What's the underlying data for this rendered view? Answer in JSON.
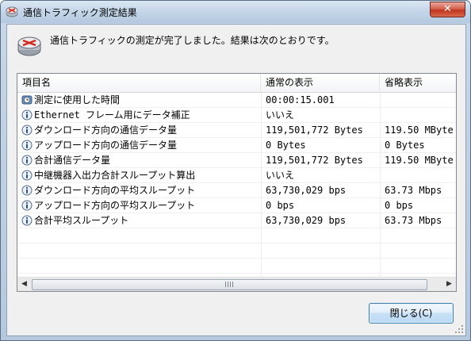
{
  "window": {
    "title": "通信トラフィック測定結果",
    "close_symbol": "✕"
  },
  "message": "通信トラフィックの測定が完了しました。結果は次のとおりです。",
  "table": {
    "columns": [
      "項目名",
      "通常の表示",
      "省略表示"
    ],
    "rows": [
      {
        "icon": "clock-icon",
        "name": "測定に使用した時間",
        "normal": "00:00:15.001",
        "short": ""
      },
      {
        "icon": "info-icon",
        "name": "Ethernet フレーム用にデータ補正",
        "normal": "いいえ",
        "short": ""
      },
      {
        "icon": "info-icon",
        "name": "ダウンロード方向の通信データ量",
        "normal": "119,501,772 Bytes",
        "short": "119.50 MByte"
      },
      {
        "icon": "info-icon",
        "name": "アップロード方向の通信データ量",
        "normal": "0 Bytes",
        "short": "0 Bytes"
      },
      {
        "icon": "info-icon",
        "name": "合計通信データ量",
        "normal": "119,501,772 Bytes",
        "short": "119.50 MByte"
      },
      {
        "icon": "info-icon",
        "name": "中継機器入出力合計スループット算出",
        "normal": "いいえ",
        "short": ""
      },
      {
        "icon": "info-icon",
        "name": "ダウンロード方向の平均スループット",
        "normal": "63,730,029 bps",
        "short": "63.73 Mbps"
      },
      {
        "icon": "info-icon",
        "name": "アップロード方向の平均スループット",
        "normal": "0 bps",
        "short": "0 bps"
      },
      {
        "icon": "info-icon",
        "name": "合計平均スループット",
        "normal": "63,730,029 bps",
        "short": "63.73 Mbps"
      }
    ]
  },
  "scrollbar": {
    "left_arrow": "◀",
    "right_arrow": "▶"
  },
  "buttons": {
    "close_label": "閉じる(C)"
  }
}
